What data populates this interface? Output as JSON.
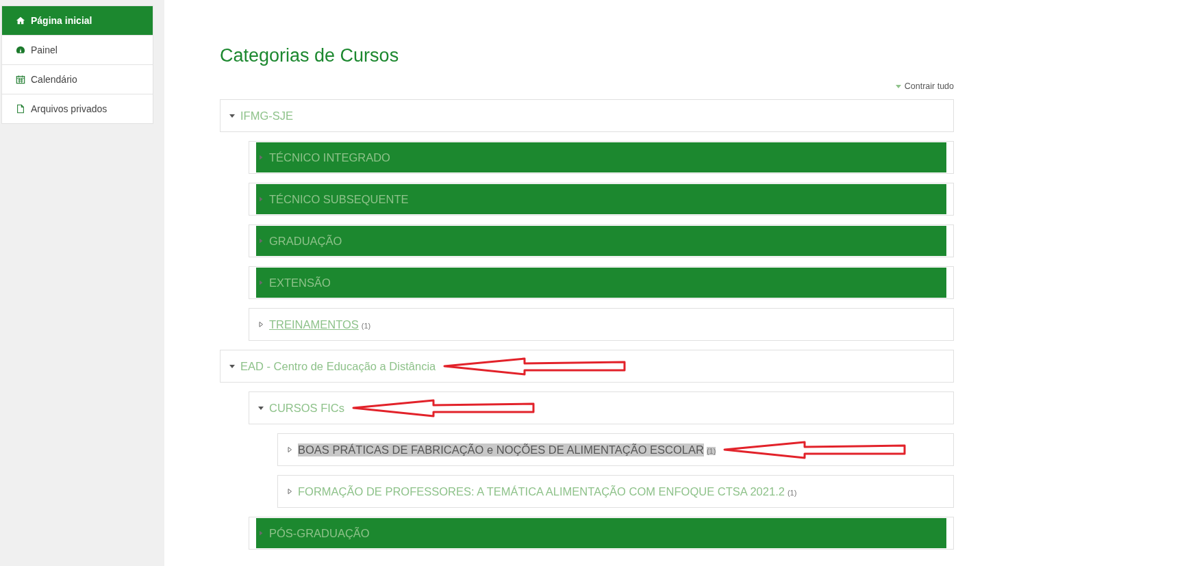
{
  "sidebar": {
    "items": [
      {
        "label": "Página inicial",
        "kind": "home",
        "selected": true
      },
      {
        "label": "Painel",
        "kind": "dashboard",
        "selected": false
      },
      {
        "label": "Calendário",
        "kind": "calendar",
        "selected": false
      },
      {
        "label": "Arquivos privados",
        "kind": "file",
        "selected": false
      }
    ]
  },
  "page_title": "Categorias de Cursos",
  "collapse_all": "Contrair tudo",
  "categories": [
    {
      "title": "IFMG-SJE",
      "expanded": true,
      "highlighted": false,
      "selected": false,
      "hovered": false,
      "annotated": false,
      "children": [
        {
          "title": "TÉCNICO INTEGRADO",
          "expanded": false,
          "highlighted": true,
          "selected": false,
          "hovered": false,
          "annotated": false
        },
        {
          "title": "TÉCNICO SUBSEQUENTE",
          "expanded": false,
          "highlighted": true,
          "selected": false,
          "hovered": false,
          "annotated": false
        },
        {
          "title": "GRADUAÇÃO",
          "expanded": false,
          "highlighted": true,
          "selected": false,
          "hovered": false,
          "annotated": false
        },
        {
          "title": "EXTENSÃO",
          "expanded": false,
          "highlighted": true,
          "selected": false,
          "hovered": false,
          "annotated": false
        },
        {
          "title": "TREINAMENTOS",
          "count": "(1)",
          "expanded": false,
          "highlighted": false,
          "selected": false,
          "hovered": true,
          "annotated": false
        }
      ]
    },
    {
      "title": "EAD - Centro de Educação a Distância",
      "expanded": true,
      "highlighted": false,
      "selected": false,
      "hovered": false,
      "annotated": true,
      "children": [
        {
          "title": "CURSOS FICs",
          "expanded": true,
          "highlighted": false,
          "selected": false,
          "hovered": false,
          "annotated": true,
          "children": [
            {
              "title": "BOAS PRÁTICAS DE FABRICAÇÃO e NOÇÕES DE ALIMENTAÇÃO ESCOLAR",
              "count": "(1)",
              "expanded": false,
              "highlighted": false,
              "selected": true,
              "hovered": false,
              "annotated": true
            },
            {
              "title": "FORMAÇÃO DE PROFESSORES: A TEMÁTICA ALIMENTAÇÃO COM ENFOQUE CTSA 2021.2",
              "count": "(1)",
              "expanded": false,
              "highlighted": false,
              "selected": false,
              "hovered": false,
              "annotated": false
            }
          ]
        },
        {
          "title": "PÓS-GRADUAÇÃO",
          "expanded": false,
          "highlighted": true,
          "selected": false,
          "hovered": false,
          "annotated": false
        }
      ]
    }
  ]
}
